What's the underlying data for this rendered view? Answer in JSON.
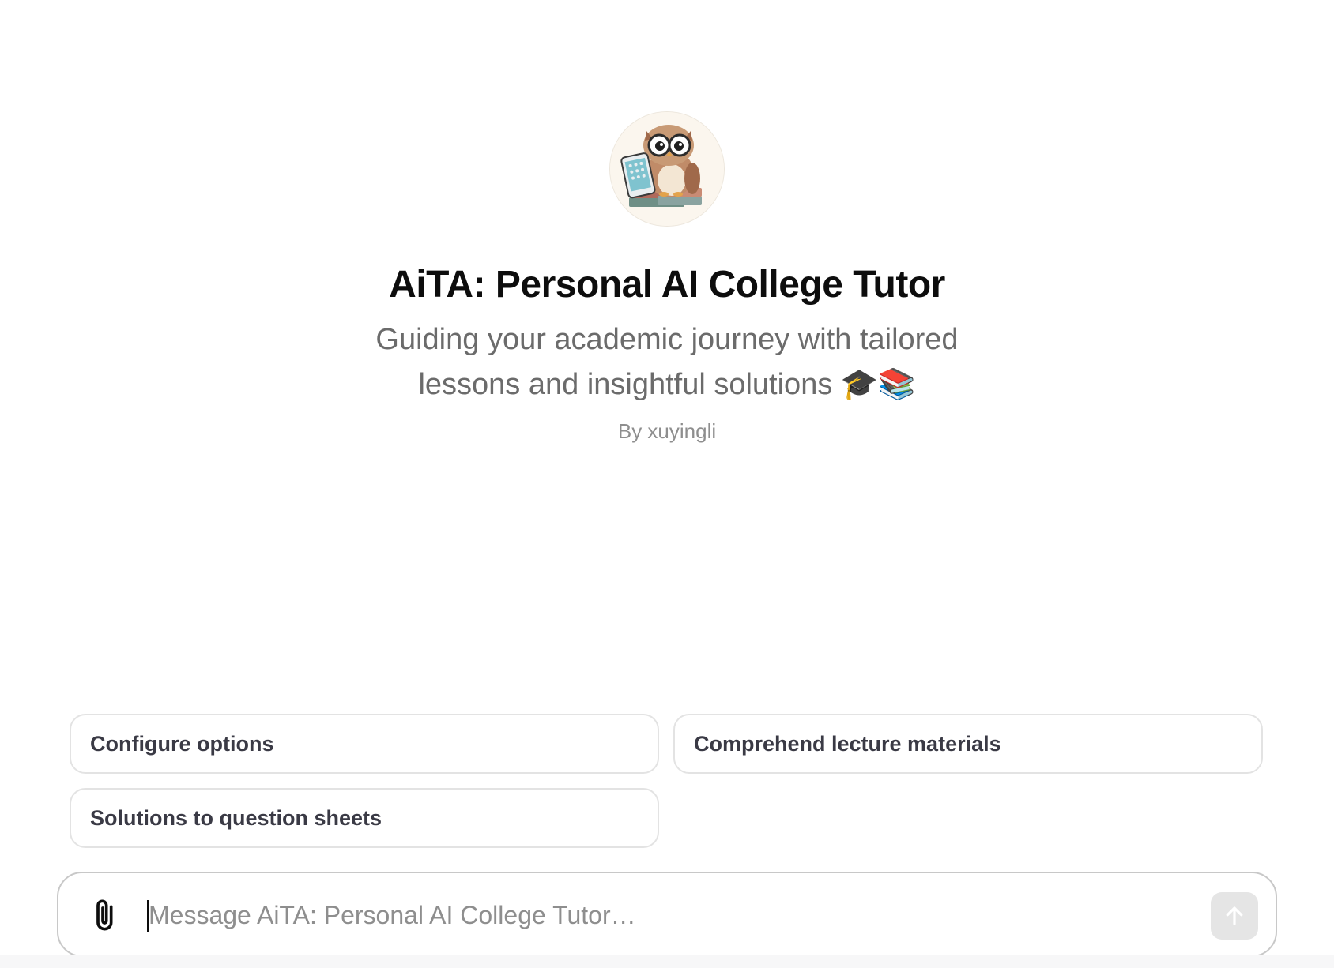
{
  "gpt": {
    "title": "AiTA: Personal AI College Tutor",
    "description": "Guiding your academic journey with tailored lessons and insightful solutions",
    "description_emoji": "🎓📚",
    "author": "By xuyingli",
    "avatar_icon": "owl-with-tablet-and-books"
  },
  "conversation_starters": [
    {
      "label": "Configure options"
    },
    {
      "label": "Comprehend lecture materials"
    },
    {
      "label": "Solutions to question sheets"
    }
  ],
  "composer": {
    "placeholder": "Message AiTA: Personal AI College Tutor…",
    "value": "",
    "attach_icon": "paperclip-icon",
    "send_icon": "arrow-up-icon"
  },
  "colors": {
    "background": "#ffffff",
    "title": "#0d0d0d",
    "subtitle": "#6b6b6b",
    "starter_text": "#3a3a45",
    "starter_border": "#e3e3e3",
    "send_button_disabled": "#e5e5e5"
  }
}
